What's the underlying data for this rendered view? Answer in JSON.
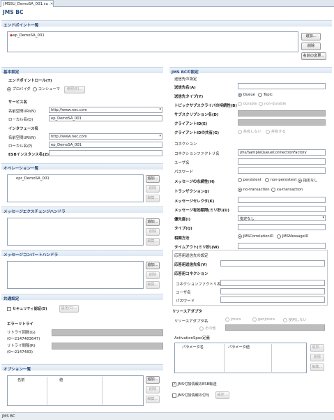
{
  "tab": {
    "label": "JMSSU_DemoSA_001.su",
    "close": "✕"
  },
  "app_title": "JMS BC",
  "endpoint": {
    "header": "エンドポイント一覧",
    "item": "ep_DemoSA_001",
    "add": "追加...",
    "delete": "削除",
    "rename": "名前の変更..."
  },
  "basic": {
    "header": "基本設定",
    "role_label": "エンドポイントロール(T)",
    "provider": "プロバイダ",
    "consumer": "コンシューマ",
    "ref": "参照(E)...",
    "service_title": "サービス名",
    "ns_label": "名前空間URI(N)",
    "ns_value": "http://www.nec.com",
    "local_label": "ローカル名(Q)",
    "local_value": "ep_DemoSA_001",
    "iface_title": "インタフェース名",
    "iface_ns_label": "名前空間URI(N)",
    "iface_ns_value": "http://www.nec.com",
    "iface_local_label": "ローカル名(P)",
    "iface_local_value": "ep_DemoSA_001",
    "esb_label": "ESBインスタンス名(Z)"
  },
  "operations": {
    "header": "オペレーション一覧",
    "item": "opr_DemoSA_001",
    "add": "追加...",
    "delete": "削除",
    "edit": "編集..."
  },
  "mex_handler": {
    "header": "メッセージエクスチェンジハンドラ",
    "add": "追加...",
    "delete": "削除",
    "edit": "編集..."
  },
  "msg_handler": {
    "header": "メッセージコンバートハンドラ",
    "add": "追加...",
    "delete": "削除",
    "edit": "編集..."
  },
  "common": {
    "header": "共通設定",
    "security_label": "セキュリティ認証(S)",
    "settings": "設定(C)...",
    "error_retry": "エラーリトライ",
    "retry_count_label": "リトライ回数(G)",
    "retry_count_range": "(0〜2147483647)",
    "retry_interval_label": "リトライ間隔(R)",
    "retry_interval_range": "(0〜2147483)"
  },
  "options": {
    "header": "オプション一覧",
    "col_name": "名前",
    "col_value": "値",
    "add": "追加...",
    "delete": "削除",
    "edit": "編集..."
  },
  "jms": {
    "header": "JMS BCの設定",
    "dest_section": "送信先の設定",
    "dest_name": "送信先名(A)",
    "dest_type": "送信先タイプ(Y)",
    "queue": "Queue",
    "topic": "Topic",
    "topic_persist": "トピックサブスクライバの持続性(B)",
    "durable": "durable",
    "non_durable": "non-durable",
    "subscription": "サブスクリプション名(D)",
    "client_id": "クライアントID(E)",
    "client_share": "クライアントIDの共有(G)",
    "no_share": "共有しない",
    "share": "共有する",
    "connection": "コネクション",
    "factory_label": "コネクションファクトリ名",
    "factory_value": "jms/SampleQueueConnectionFactory",
    "user": "ユーザ名",
    "password": "パスワード",
    "persist_label": "メッセージの永続性(H)",
    "persistent": "persistent",
    "non_persistent": "non-persistent",
    "unspecified": "指定なし",
    "transaction": "トランザクション(J)",
    "no_transaction": "no-transaction",
    "xa_transaction": "xa-transaction",
    "selector": "メッセージセレクタ(K)",
    "expire": "メッセージ有効期限(ミリ秒)(U)",
    "priority": "優先度(I)",
    "priority_value": "指定なし",
    "type": "タイプ(Q)",
    "correlation": "相関方法",
    "corr_id": "JMSCorrelationID",
    "msg_id": "JMSMessageID",
    "timeout": "タイムアウト(ミリ秒)(W)",
    "reply_section": "応答用送信先の設定",
    "reply_dest": "応答用送信先名(V)",
    "reply_conn": "応答用コネクション",
    "reply_factory": "コネクションファクトリ名",
    "reply_user": "ユーザ名",
    "reply_password": "パスワード"
  },
  "adapter": {
    "title": "リソースアダプタ",
    "name_label": "リソースアダプタ名",
    "jmsra": "jmsra",
    "genjmsra": "genjmsra",
    "none": "使用しない",
    "other": "その他",
    "activation": "ActivationSpec定義",
    "col_param": "パラメータ名",
    "col_value": "パラメータ値",
    "add": "追加...",
    "delete": "削除",
    "edit": "編集...",
    "esb_transfer": "JMS付加情報のESB転送",
    "jms_assign": "JMS付加情報の付与",
    "settings": "設定..."
  },
  "status": {
    "label": "JMS BC"
  }
}
